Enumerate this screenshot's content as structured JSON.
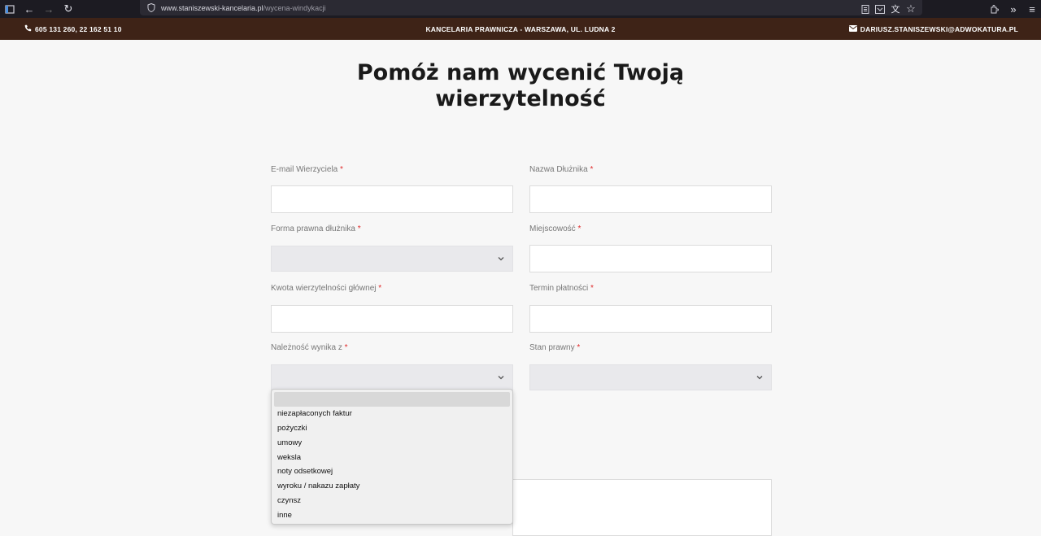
{
  "browser": {
    "url_host": "www.staniszewski-kancelaria.pl",
    "url_path": "/wycena-windykacji"
  },
  "topbar": {
    "phone": "605 131 260, 22 162 51 10",
    "center": "KANCELARIA PRAWNICZA - WARSZAWA, UL. LUDNA 2",
    "email": "DARIUSZ.STANISZEWSKI@ADWOKATURA.PL"
  },
  "page": {
    "title_line1": "Pomóż nam wycenić Twoją",
    "title_line2": "wierzytelność"
  },
  "form": {
    "email_label": "E-mail Wierzyciela",
    "debtor_name_label": "Nazwa Dłużnika",
    "legal_form_label": "Forma prawna dłużnika",
    "city_label": "Miejscowość",
    "amount_label": "Kwota wierzytelności głównej",
    "due_date_label": "Termin płatności",
    "source_label": "Należność wynika z",
    "legal_status_label": "Stan prawny",
    "required_mark": "*"
  },
  "dropdown": {
    "options": [
      "",
      "niezapłaconych faktur",
      "pożyczki",
      "umowy",
      "weksla",
      "noty odsetkowej",
      "wyroku / nakazu zapłaty",
      "czynsz",
      "inne"
    ]
  }
}
